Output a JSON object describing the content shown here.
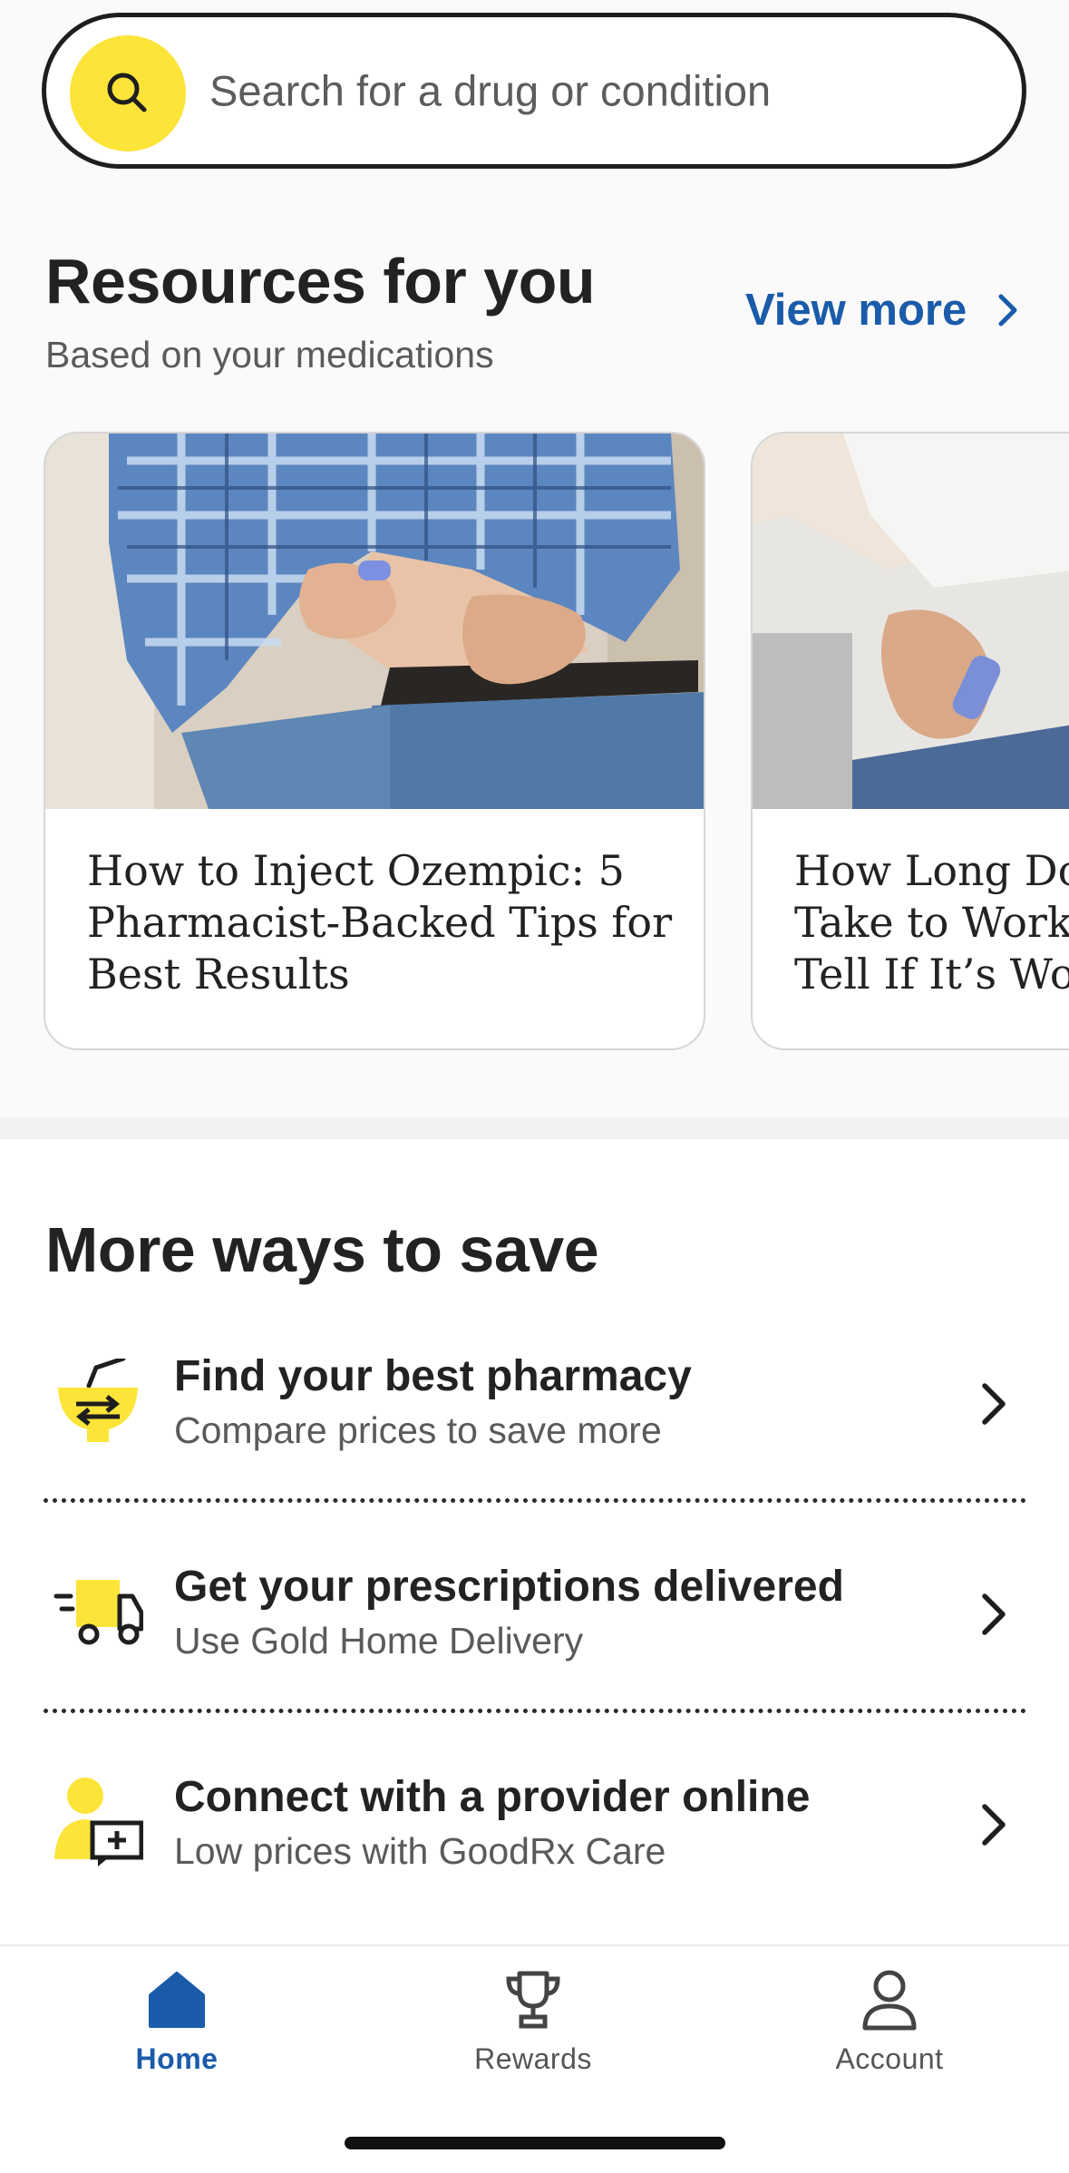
{
  "search": {
    "placeholder": "Search for a drug or condition"
  },
  "resources": {
    "title": "Resources for you",
    "subtitle": "Based on your medications",
    "view_more": "View more",
    "cards": [
      {
        "title": "How to Inject Ozempic: 5 Pharmacist-Backed Tips for Best Results"
      },
      {
        "title_lines": [
          "How Long Do",
          "Take to Work?",
          "Tell If It’s Wor"
        ]
      }
    ]
  },
  "save": {
    "title": "More ways to save",
    "items": [
      {
        "heading": "Find your best pharmacy",
        "sub": "Compare prices to save more",
        "icon": "pharmacy-mortar-icon"
      },
      {
        "heading": "Get your prescriptions delivered",
        "sub": "Use Gold Home Delivery",
        "icon": "delivery-truck-icon"
      },
      {
        "heading": "Connect with a provider online",
        "sub": "Low prices with GoodRx Care",
        "icon": "provider-chat-icon"
      }
    ]
  },
  "nav": {
    "items": [
      {
        "label": "Home",
        "icon": "home-icon",
        "active": true
      },
      {
        "label": "Rewards",
        "icon": "trophy-icon",
        "active": false
      },
      {
        "label": "Account",
        "icon": "person-icon",
        "active": false
      }
    ]
  },
  "colors": {
    "accent_yellow": "#fde439",
    "link_blue": "#1a5baa",
    "text_dark": "#222222",
    "text_muted": "#5a5a5a"
  }
}
